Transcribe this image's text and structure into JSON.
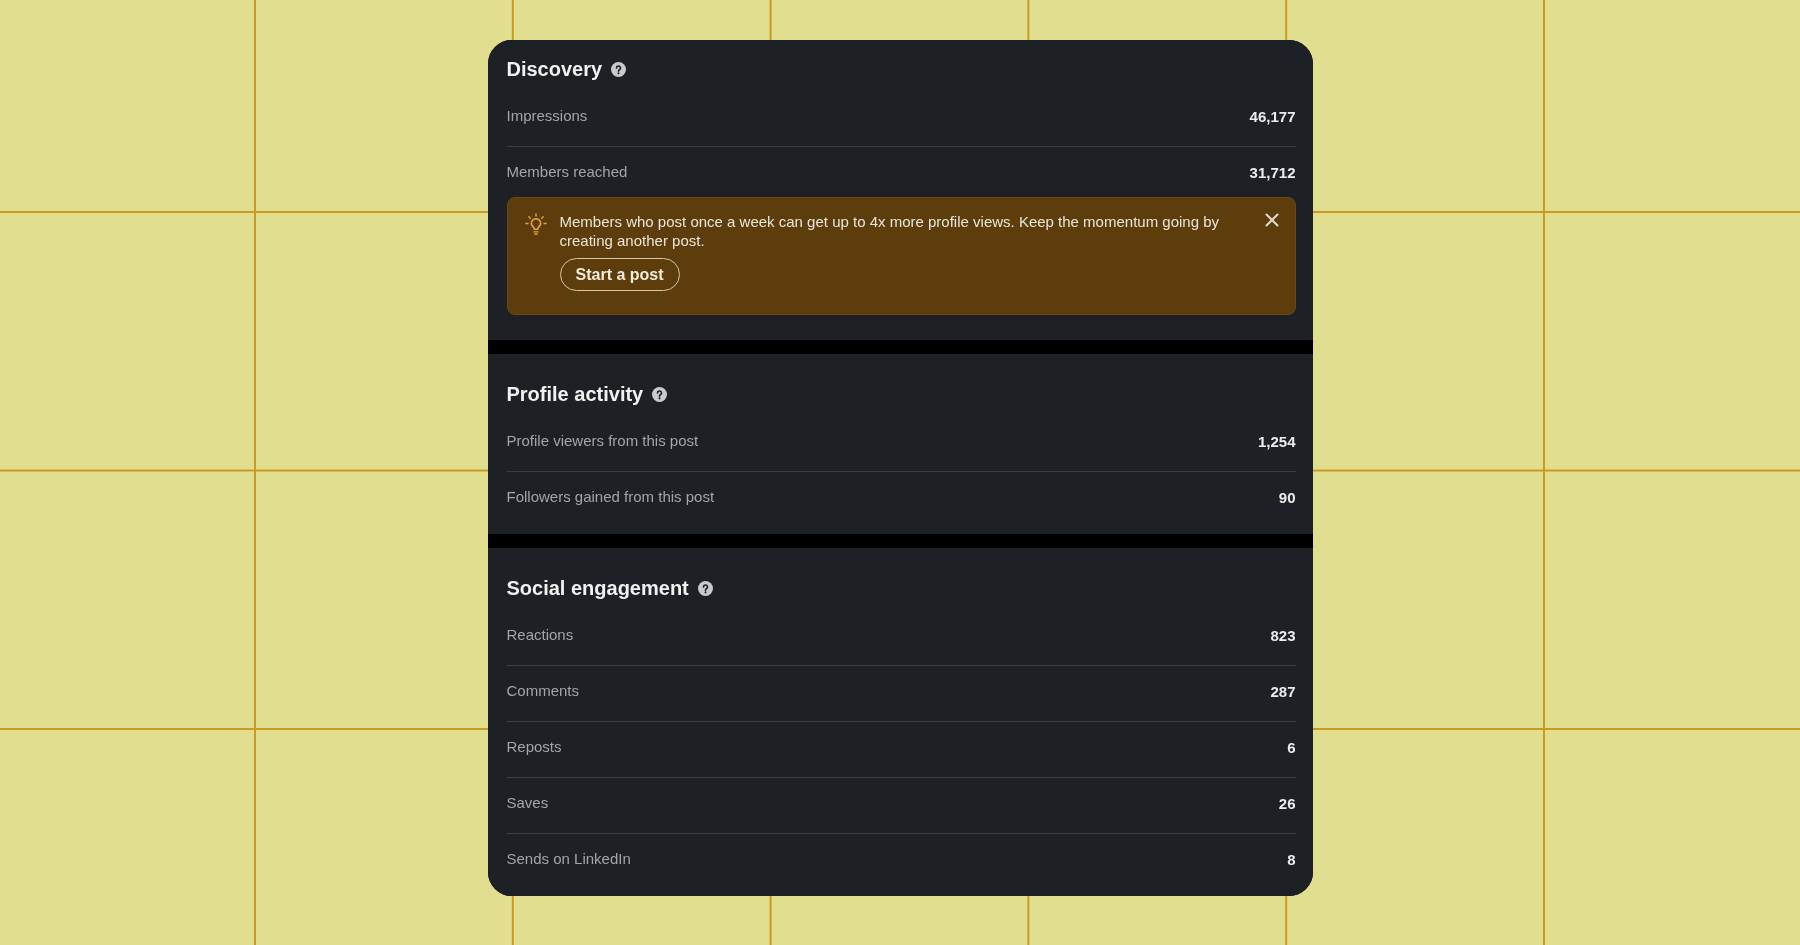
{
  "sections": [
    {
      "title": "Discovery",
      "rows": [
        {
          "label": "Impressions",
          "value": "46,177"
        },
        {
          "label": "Members reached",
          "value": "31,712"
        }
      ],
      "tip": {
        "text": "Members who post once a week can get up to 4x more profile views. Keep the momentum going by creating another post.",
        "button": "Start a post"
      }
    },
    {
      "title": "Profile activity",
      "rows": [
        {
          "label": "Profile viewers from this post",
          "value": "1,254"
        },
        {
          "label": "Followers gained from this post",
          "value": "90"
        }
      ]
    },
    {
      "title": "Social engagement",
      "rows": [
        {
          "label": "Reactions",
          "value": "823"
        },
        {
          "label": "Comments",
          "value": "287"
        },
        {
          "label": "Reposts",
          "value": "6"
        },
        {
          "label": "Saves",
          "value": "26"
        },
        {
          "label": "Sends on LinkedIn",
          "value": "8"
        }
      ]
    }
  ]
}
